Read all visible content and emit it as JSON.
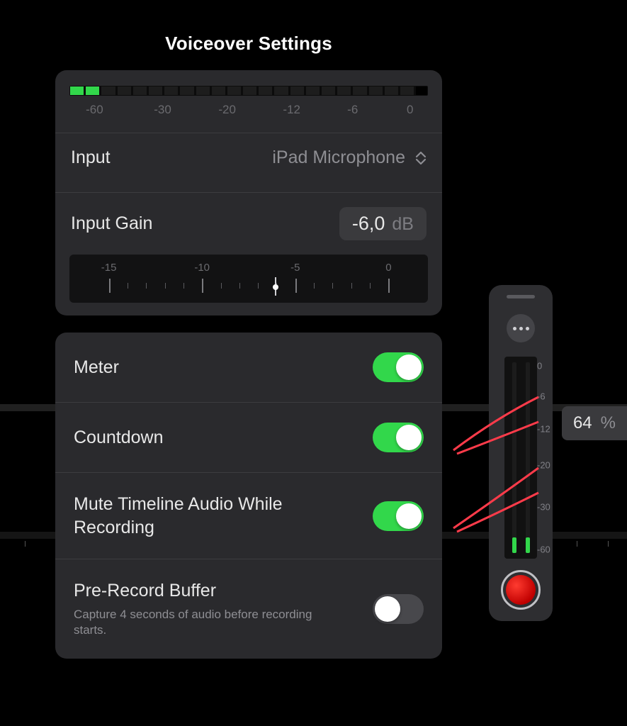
{
  "panel": {
    "title": "Voiceover Settings",
    "meter_ticks": [
      "-60",
      "-30",
      "-20",
      "-12",
      "-6",
      "0"
    ],
    "input_label": "Input",
    "input_value": "iPad Microphone",
    "gain_label": "Input Gain",
    "gain_value": "-6,0",
    "gain_unit": "dB",
    "slider_ticks": [
      "-15",
      "-10",
      "-5",
      "0"
    ],
    "slider_pos_pct": 58
  },
  "options": [
    {
      "label": "Meter",
      "desc": "",
      "on": true
    },
    {
      "label": "Countdown",
      "desc": "",
      "on": true
    },
    {
      "label": "Mute Timeline Audio While Recording",
      "desc": "",
      "on": true
    },
    {
      "label": "Pre-Record Buffer",
      "desc": "Capture 4 seconds of audio before recording starts.",
      "on": false
    }
  ],
  "recorder": {
    "vmeter_labels": [
      "0",
      "-6",
      "-12",
      "-20",
      "-30",
      "-60"
    ],
    "level_pct": 8
  },
  "zoom": {
    "value": "64",
    "unit": "%"
  }
}
